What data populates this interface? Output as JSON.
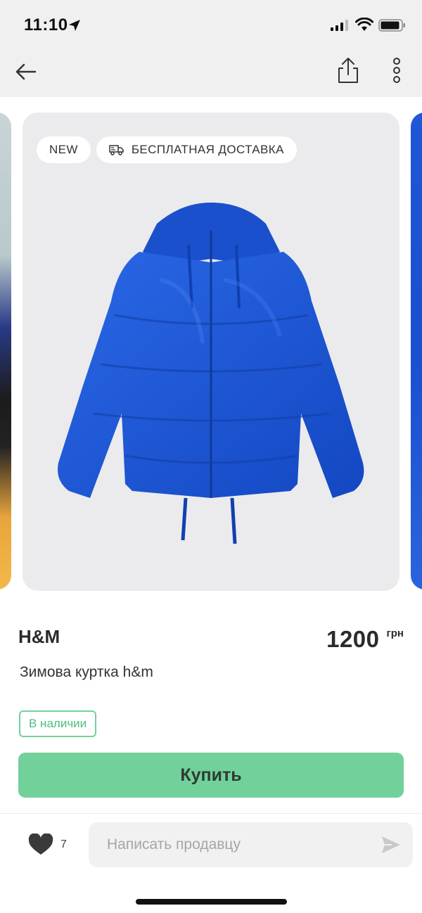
{
  "status_bar": {
    "time": "11:10"
  },
  "product": {
    "badges": {
      "new": "NEW",
      "delivery": "БЕСПЛАТНАЯ ДОСТАВКА"
    },
    "brand": "H&M",
    "price": "1200",
    "currency": "грн",
    "title": "Зимова куртка h&m",
    "stock_status": "В наличии",
    "buy_label": "Купить",
    "jacket_color": "#1f5ad8"
  },
  "bottom_bar": {
    "likes": "7",
    "message_placeholder": "Написать продавцу"
  },
  "colors": {
    "accent_green": "#72d19a",
    "stock_green": "#4bbf7c",
    "bar_gray": "#f0f0f0"
  },
  "icons": [
    "location-arrow-icon",
    "signal-icon",
    "wifi-icon",
    "battery-icon",
    "back-arrow-icon",
    "share-icon",
    "more-vertical-icon",
    "truck-icon",
    "heart-icon",
    "send-icon"
  ]
}
